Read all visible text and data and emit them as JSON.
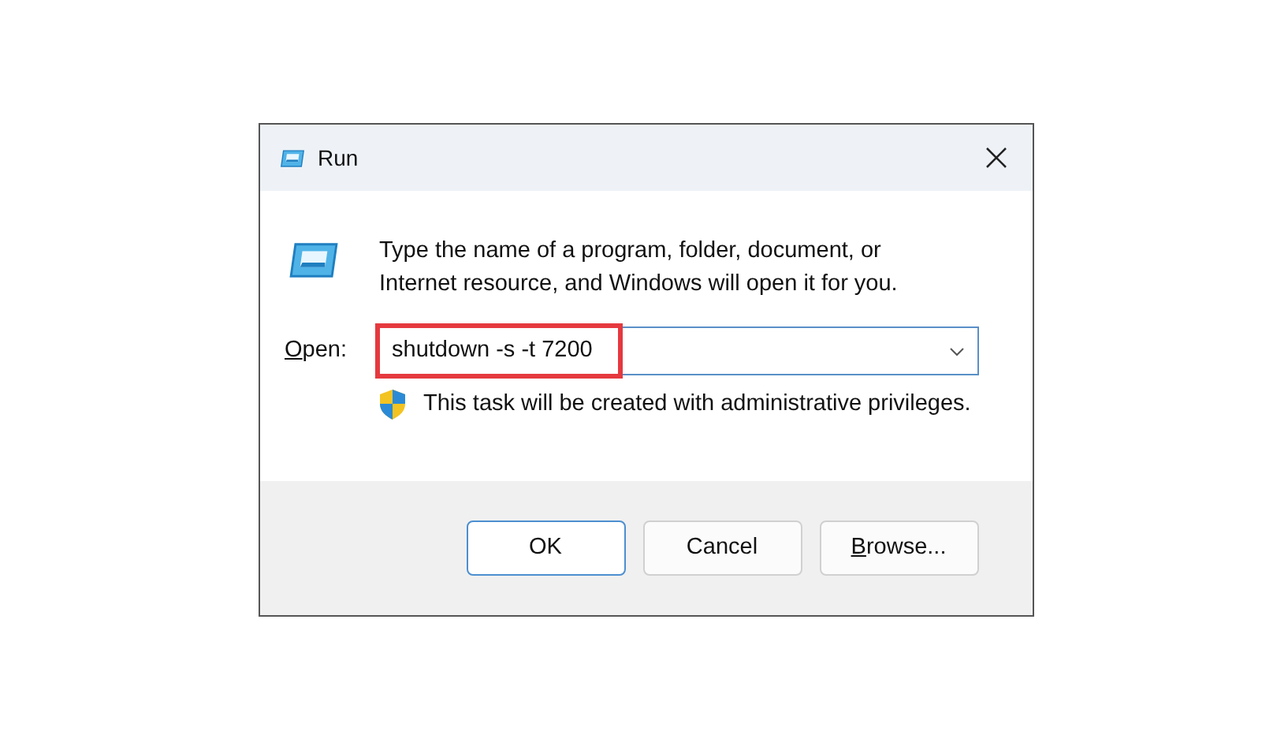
{
  "window": {
    "title": "Run"
  },
  "message": "Type the name of a program, folder, document, or Internet resource, and Windows will open it for you.",
  "open_field": {
    "label": {
      "access_key": "O",
      "rest": "pen:"
    },
    "value": "shutdown -s -t 7200",
    "highlighted": true
  },
  "admin_note": "This task will be created with administrative privileges.",
  "buttons": [
    {
      "label": {
        "rest": "OK"
      },
      "default": true
    },
    {
      "label": {
        "rest": "Cancel"
      },
      "default": false
    },
    {
      "label": {
        "access_key": "B",
        "rest": "rowse..."
      },
      "default": false
    }
  ]
}
